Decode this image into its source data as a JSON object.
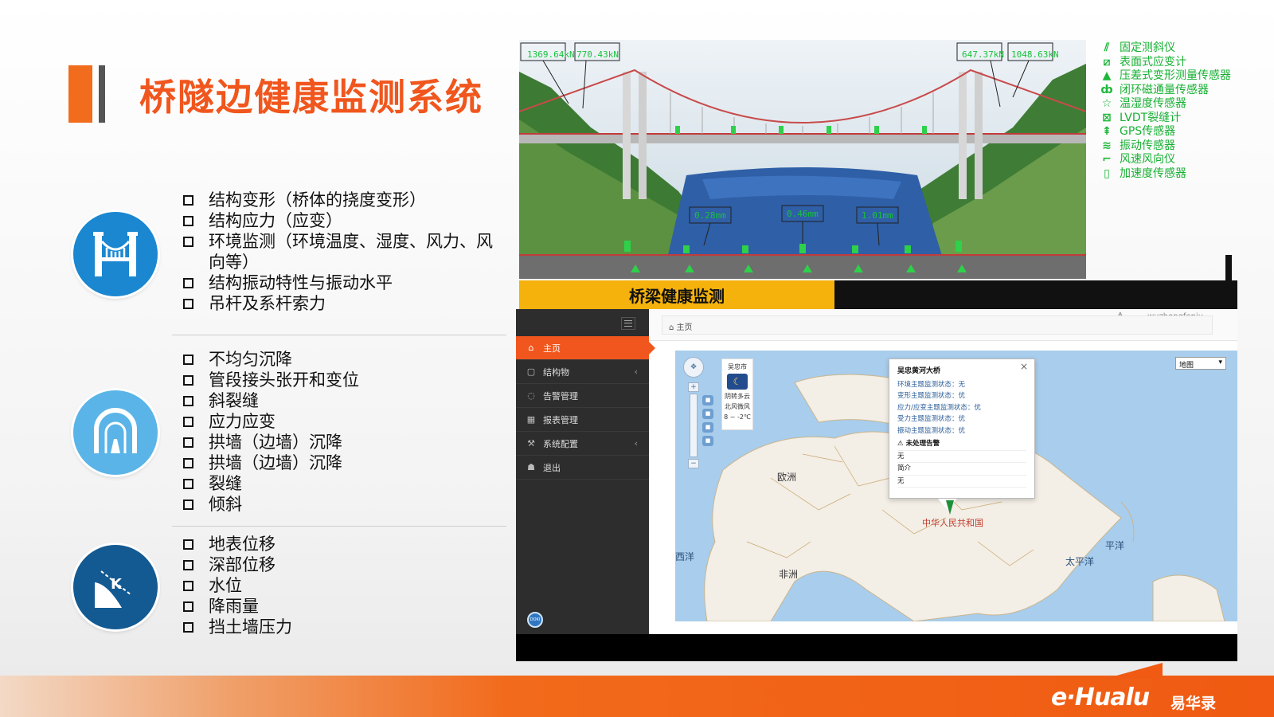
{
  "title": "桥隧边健康监测系统",
  "bridge_items": [
    "结构变形（桥体的挠度变形）",
    "结构应力（应变）",
    "环境监测（环境温度、湿度、风力、风向等）",
    "结构振动特性与振动水平",
    "吊杆及系杆索力"
  ],
  "tunnel_items": [
    "不均匀沉降",
    "管段接头张开和变位",
    "斜裂缝",
    "应力应变",
    "拱墙（边墙）沉降",
    "拱墙（边墙）沉降",
    "裂缝",
    "倾斜"
  ],
  "slope_items": [
    "地表位移",
    "深部位移",
    "水位",
    "降雨量",
    "挡土墙压力"
  ],
  "bridge_view": {
    "cable_force_labels": [
      "1369.64kN",
      "770.43kN",
      "647.37kN",
      "1048.63kN"
    ],
    "deflection_labels": [
      "0.28mm",
      "0.46mm",
      "1.01mm"
    ]
  },
  "legend": [
    {
      "icon": "inclinometer-icon",
      "symbol": "⫽",
      "label": "固定测斜仪"
    },
    {
      "icon": "strain-gauge-icon",
      "symbol": "⧄",
      "label": "表面式应变计"
    },
    {
      "icon": "triangle-icon",
      "symbol": "▲",
      "label": "压差式变形测量传感器"
    },
    {
      "icon": "ring-icon",
      "symbol": "ȸ",
      "label": "闭环磁通量传感器"
    },
    {
      "icon": "star-icon",
      "symbol": "☆",
      "label": "温湿度传感器"
    },
    {
      "icon": "lvdt-icon",
      "symbol": "⊠",
      "label": "LVDT裂缝计"
    },
    {
      "icon": "gps-icon",
      "symbol": "⇞",
      "label": "GPS传感器"
    },
    {
      "icon": "vibration-icon",
      "symbol": "≋",
      "label": "振动传感器"
    },
    {
      "icon": "wind-icon",
      "symbol": "⌐",
      "label": "风速风向仪"
    },
    {
      "icon": "accelerometer-icon",
      "symbol": "▯",
      "label": "加速度传感器"
    }
  ],
  "banner": "桥梁健康监测",
  "app": {
    "user": "wuzhongfenju",
    "breadcrumb": "主页",
    "menu": [
      {
        "label": "主页",
        "icon": "home-icon",
        "glyph": "⌂",
        "active": true,
        "has_arrow": false
      },
      {
        "label": "结构物",
        "icon": "file-icon",
        "glyph": "▢",
        "active": false,
        "has_arrow": true
      },
      {
        "label": "告警管理",
        "icon": "bell-icon",
        "glyph": "◌",
        "active": false,
        "has_arrow": false
      },
      {
        "label": "报表管理",
        "icon": "table-icon",
        "glyph": "▦",
        "active": false,
        "has_arrow": false
      },
      {
        "label": "系统配置",
        "icon": "wrench-icon",
        "glyph": "⚒",
        "active": false,
        "has_arrow": true
      },
      {
        "label": "退出",
        "icon": "user-icon",
        "glyph": "☗",
        "active": false,
        "has_arrow": false
      }
    ],
    "map": {
      "type_select": "地图",
      "weather": {
        "city": "吴忠市",
        "desc": "阴转多云",
        "wind": "北风微风",
        "temp": "8 ~ -2℃"
      },
      "labels": {
        "europe": "欧洲",
        "china": "中华人民共和国",
        "pacific": "太平洋",
        "pacific2": "平洋",
        "africa": "非洲",
        "ocean_left": "西洋"
      },
      "popup": {
        "title": "吴忠黄河大桥",
        "lines": [
          "环境主题监测状态：无",
          "变形主题监测状态：优",
          "应力/应变主题监测状态：优",
          "受力主题监测状态：优",
          "振动主题监测状态：优"
        ],
        "alert_title": "未处理告警",
        "alert_value": "无",
        "intro_title": "简介",
        "intro_value": "无"
      }
    }
  },
  "footer": {
    "brand": "e·Hualu",
    "brand_cn": "易华录"
  }
}
